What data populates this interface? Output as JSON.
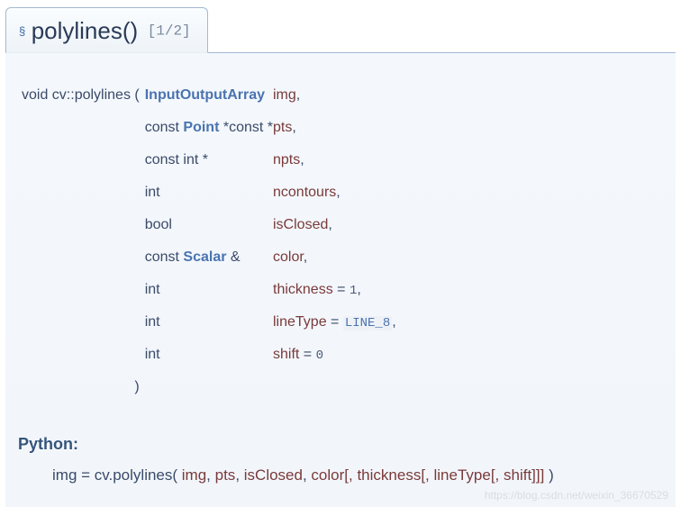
{
  "tab": {
    "section_mark": "§",
    "title": "polylines()",
    "counter": "[1/2]"
  },
  "signature": {
    "prefix": "void cv::polylines",
    "open_paren": "(",
    "close_paren": ")",
    "rows": [
      {
        "type_pre": "",
        "type_link": "InputOutputArray",
        "type_post": "",
        "param": "img",
        "suffix": ","
      },
      {
        "type_pre": "const ",
        "type_link": "Point",
        "type_post": " *const *",
        "param": "pts",
        "suffix": ","
      },
      {
        "type_pre": "const int *",
        "type_link": "",
        "type_post": "",
        "param": "npts",
        "suffix": ","
      },
      {
        "type_pre": "int",
        "type_link": "",
        "type_post": "",
        "param": "ncontours",
        "suffix": ","
      },
      {
        "type_pre": "bool",
        "type_link": "",
        "type_post": "",
        "param": "isClosed",
        "suffix": ","
      },
      {
        "type_pre": "const ",
        "type_link": "Scalar",
        "type_post": " &",
        "param": "color",
        "suffix": ","
      },
      {
        "type_pre": "int",
        "type_link": "",
        "type_post": "",
        "param": "thickness",
        "default_plain": " = ",
        "default_value": "1",
        "default_kind": "num",
        "suffix": ","
      },
      {
        "type_pre": "int",
        "type_link": "",
        "type_post": "",
        "param": "lineType",
        "default_plain": " = ",
        "default_value": "LINE_8",
        "default_kind": "mono",
        "suffix": ","
      },
      {
        "type_pre": "int",
        "type_link": "",
        "type_post": "",
        "param": "shift",
        "default_plain": " = ",
        "default_value": "0",
        "default_kind": "num",
        "suffix": ""
      }
    ]
  },
  "python": {
    "label": "Python:",
    "lhs": "img = cv.polylines(",
    "params": [
      {
        "text": "img",
        "cls": "param-name"
      },
      {
        "text": ", ",
        "cls": ""
      },
      {
        "text": "pts",
        "cls": "param-name"
      },
      {
        "text": ", ",
        "cls": ""
      },
      {
        "text": "isClosed",
        "cls": "param-name"
      },
      {
        "text": ", ",
        "cls": ""
      },
      {
        "text": "color[, ",
        "cls": "param-name"
      },
      {
        "text": "thickness[, ",
        "cls": "param-name"
      },
      {
        "text": "lineType[, ",
        "cls": "param-name"
      },
      {
        "text": "shift]]]",
        "cls": "param-name"
      }
    ],
    "rhs": " )"
  },
  "watermark": "https://blog.csdn.net/weixin_36670529"
}
